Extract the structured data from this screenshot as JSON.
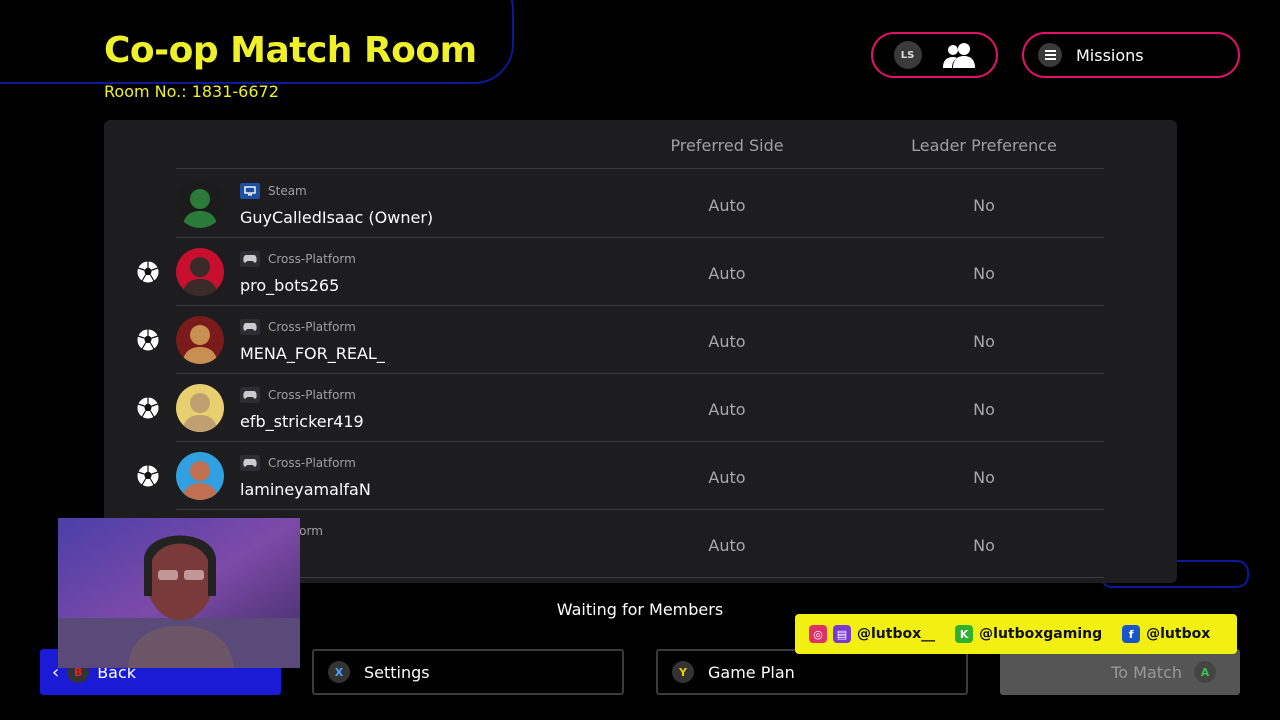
{
  "header": {
    "title": "Co-op Match Room",
    "room_number": "Room No.: 1831-6672",
    "friends_button_hint": "LS",
    "missions_label": "Missions"
  },
  "table": {
    "columns": [
      "Preferred Side",
      "Leader Preference"
    ],
    "rows": [
      {
        "platform": "Steam",
        "platform_icon": "pc-icon",
        "name": "GuyCalledIsaac (Owner)",
        "preferred_side": "Auto",
        "leader_preference": "No",
        "ball": false
      },
      {
        "platform": "Cross-Platform",
        "platform_icon": "gamepad-icon",
        "name": "pro_bots265",
        "preferred_side": "Auto",
        "leader_preference": "No",
        "ball": true
      },
      {
        "platform": "Cross-Platform",
        "platform_icon": "gamepad-icon",
        "name": "MENA_FOR_REAL_",
        "preferred_side": "Auto",
        "leader_preference": "No",
        "ball": true
      },
      {
        "platform": "Cross-Platform",
        "platform_icon": "gamepad-icon",
        "name": "efb_stricker419",
        "preferred_side": "Auto",
        "leader_preference": "No",
        "ball": true
      },
      {
        "platform": "Cross-Platform",
        "platform_icon": "gamepad-icon",
        "name": "lamineyamalfaN",
        "preferred_side": "Auto",
        "leader_preference": "No",
        "ball": true
      },
      {
        "platform": "-Platform",
        "platform_icon": "",
        "name": "",
        "preferred_side": "Auto",
        "leader_preference": "No",
        "ball": false
      }
    ]
  },
  "status": "Waiting for Members",
  "footer": {
    "back": {
      "key": "B",
      "label": "Back"
    },
    "settings": {
      "key": "X",
      "label": "Settings"
    },
    "game_plan": {
      "key": "Y",
      "label": "Game Plan"
    },
    "to_match": {
      "key": "A",
      "label": "To Match"
    }
  },
  "social": {
    "instagram_twitch": "@lutbox__",
    "kick": "@lutboxgaming",
    "facebook": "@lutbox"
  },
  "colors": {
    "title": "#eef12a",
    "pill_border": "#e0126e",
    "back_button": "#1b1bd6",
    "panel": "#1d1d20",
    "social_banner": "#f2f012",
    "key_x": "#4aa3ff",
    "key_y": "#f0d000",
    "key_a": "#3cc04a",
    "key_b": "#e02020"
  }
}
